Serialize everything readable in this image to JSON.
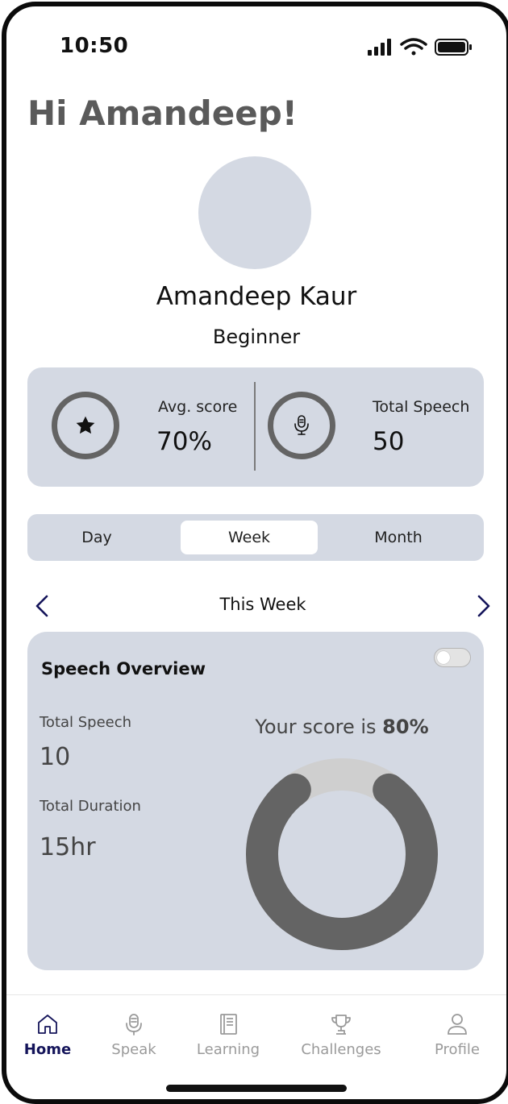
{
  "status_bar": {
    "time": "10:50",
    "icons": [
      "signal-icon",
      "wifi-icon",
      "battery-icon"
    ]
  },
  "greeting": "Hi Amandeep!",
  "profile": {
    "name": "Amandeep Kaur",
    "level": "Beginner"
  },
  "stats": {
    "avg_score": {
      "label": "Avg. score",
      "value": "70%",
      "icon": "star-icon"
    },
    "total_speech": {
      "label": "Total Speech",
      "value": "50",
      "icon": "microphone-icon"
    }
  },
  "period_tabs": {
    "items": [
      "Day",
      "Week",
      "Month"
    ],
    "selected": "Week"
  },
  "week_nav": {
    "label": "This Week"
  },
  "overview": {
    "title": "Speech Overview",
    "toggle_on": false,
    "total_speech_label": "Total Speech",
    "total_speech_value": "10",
    "total_duration_label": "Total Duration",
    "total_duration_value": "15hr",
    "score_prefix": "Your score is",
    "score_value": "80%",
    "score_fraction": 0.8
  },
  "nav": {
    "items": [
      {
        "label": "Home",
        "icon": "home-icon",
        "active": true
      },
      {
        "label": "Speak",
        "icon": "microphone-icon",
        "active": false
      },
      {
        "label": "Learning",
        "icon": "book-icon",
        "active": false
      },
      {
        "label": "Challenges",
        "icon": "trophy-icon",
        "active": false
      },
      {
        "label": "Profile",
        "icon": "user-icon",
        "active": false
      }
    ]
  },
  "colors": {
    "accent": "#14145a",
    "card": "#d4d9e3",
    "ring": "#646464",
    "muted": "#9a9a9a"
  }
}
